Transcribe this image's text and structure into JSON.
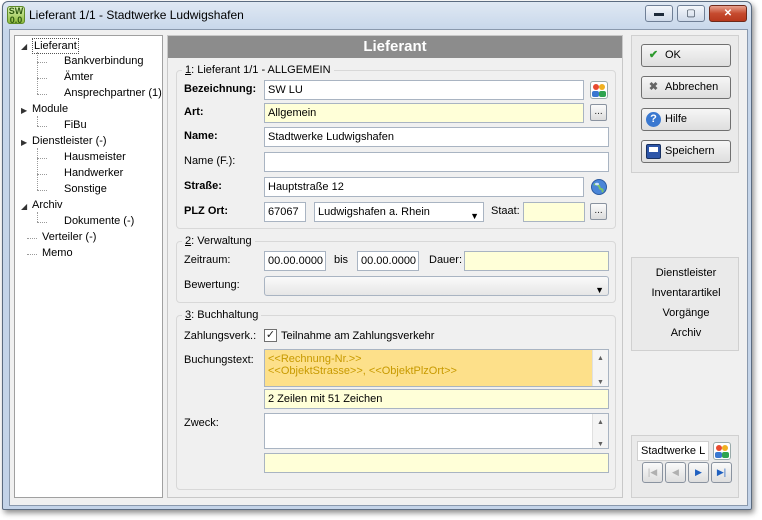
{
  "window": {
    "title": "Lieferant 1/1 - Stadtwerke Ludwigshafen",
    "icon_text": "SW 0.0",
    "controls": {
      "minimize": "▬",
      "maximize": "▢",
      "close": "✕"
    }
  },
  "tree": {
    "items": [
      {
        "label": "Lieferant",
        "level": 0,
        "expander": "◢",
        "selected": true
      },
      {
        "label": "Bankverbindung",
        "level": 1
      },
      {
        "label": "Ämter",
        "level": 1
      },
      {
        "label": "Ansprechpartner (1)",
        "level": 1
      },
      {
        "label": "Module",
        "level": 0,
        "expander": "▶"
      },
      {
        "label": "FiBu",
        "level": 1
      },
      {
        "label": "Dienstleister (-)",
        "level": 0,
        "expander": "▶"
      },
      {
        "label": "Hausmeister",
        "level": 1
      },
      {
        "label": "Handwerker",
        "level": 1
      },
      {
        "label": "Sonstige",
        "level": 1
      },
      {
        "label": "Archiv",
        "level": 0,
        "expander": "◢"
      },
      {
        "label": "Dokumente (-)",
        "level": 1
      },
      {
        "label": "Verteiler (-)",
        "level": 0
      },
      {
        "label": "Memo",
        "level": 0
      }
    ]
  },
  "main": {
    "header": "Lieferant",
    "allgemein": {
      "caption_num": "1",
      "caption_text": ": Lieferant 1/1 - ALLGEMEIN",
      "bezeichnung_label": "Bezeichnung:",
      "bezeichnung_value": "SW LU",
      "art_label": "Art:",
      "art_value": "Allgemein",
      "name_label": "Name:",
      "name_value": "Stadtwerke Ludwigshafen",
      "name_f_label": "Name (F.):",
      "name_f_value": "",
      "strasse_label": "Straße:",
      "strasse_value": "Hauptstraße 12",
      "plz_ort_label": "PLZ Ort:",
      "plz_value": "67067",
      "ort_value": "Ludwigshafen a. Rhein",
      "staat_label": "Staat:",
      "staat_value": "",
      "ellipsis": "..."
    },
    "verwaltung": {
      "caption_num": "2",
      "caption_text": ": Verwaltung",
      "zeitraum_label": "Zeitraum:",
      "von_value": "00.00.0000",
      "bis_label": "bis",
      "bis_value": "00.00.0000",
      "dauer_label": "Dauer:",
      "dauer_value": "",
      "bewertung_label": "Bewertung:",
      "bewertung_value": ""
    },
    "buchhaltung": {
      "caption_num": "3",
      "caption_text": ": Buchhaltung",
      "zahlungsverk_label": "Zahlungsverk.:",
      "teilnahme_label": "Teilnahme am Zahlungsverkehr",
      "teilnahme_checked": true,
      "check_mark": "✓",
      "buchungstext_label": "Buchungstext:",
      "buchungstext_line1": "<<Rechnung-Nr.>>",
      "buchungstext_line2": "<<ObjektStrasse>>, <<ObjektPlzOrt>>",
      "zeilen_info": "2 Zeilen mit 51 Zeichen",
      "zweck_label": "Zweck:",
      "zweck_value": "",
      "zweck_info": ""
    }
  },
  "actions": {
    "ok": "OK",
    "abbrechen": "Abbrechen",
    "hilfe": "Hilfe",
    "speichern": "Speichern"
  },
  "links": [
    "Dienstleister",
    "Inventarartikel",
    "Vorgänge",
    "Archiv"
  ],
  "record": {
    "current": "Stadtwerke L",
    "nav": {
      "first": "|◀",
      "prev": "◀",
      "next": "▶",
      "last": "▶|"
    }
  },
  "colors": {
    "header_bg": "#8c8c8c",
    "required_field": "#ffffd8",
    "buchungstext_bg": "#fde08a",
    "placeholder_text": "#c89a00"
  }
}
